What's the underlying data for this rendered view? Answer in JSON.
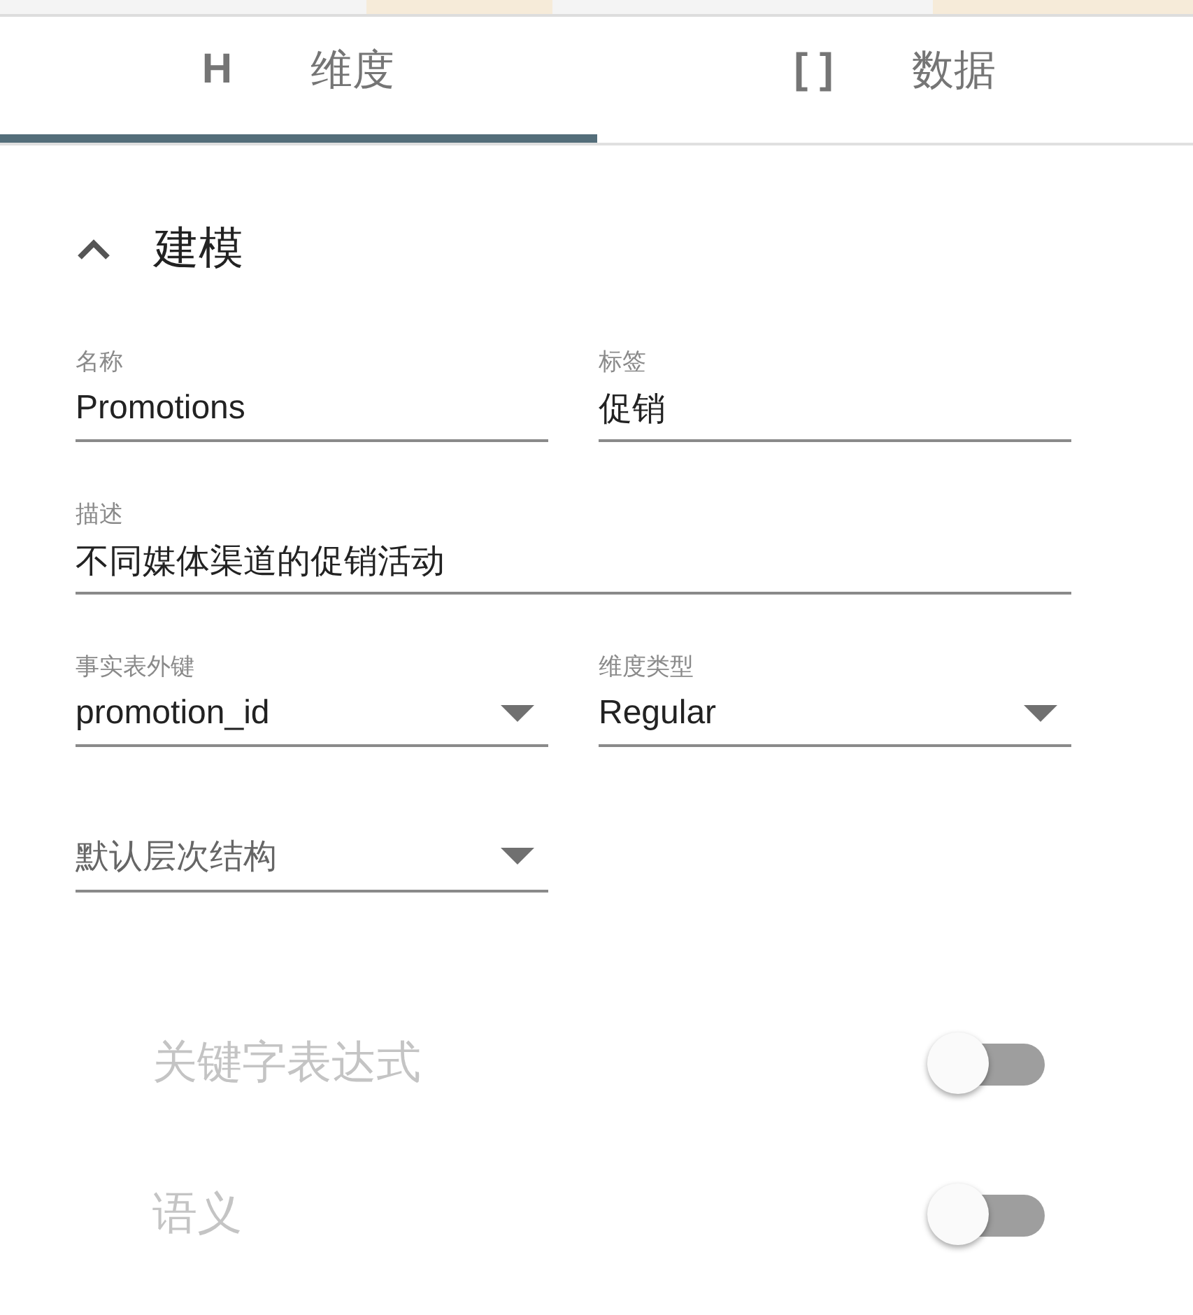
{
  "tabs": [
    {
      "icon": "H",
      "label": "维度",
      "selected": true
    },
    {
      "icon": "[ ]",
      "label": "数据",
      "selected": false
    }
  ],
  "section": {
    "title": "建模",
    "expanded": true
  },
  "rows": [
    [
      {
        "kind": "text",
        "label": "名称",
        "value": "Promotions"
      },
      {
        "kind": "text",
        "label": "标签",
        "value": "促销"
      }
    ],
    [
      {
        "kind": "text",
        "label": "描述",
        "value": "不同媒体渠道的促销活动",
        "wide": true
      }
    ],
    [
      {
        "kind": "select",
        "label": "事实表外键",
        "value": "promotion_id"
      },
      {
        "kind": "select",
        "label": "维度类型",
        "value": "Regular"
      }
    ],
    [
      {
        "kind": "select",
        "placeholder": "默认层次结构"
      }
    ]
  ],
  "toggles": [
    {
      "label": "关键字表达式",
      "on": false,
      "disabled": true
    },
    {
      "label": "语义",
      "on": false,
      "disabled": true
    }
  ]
}
